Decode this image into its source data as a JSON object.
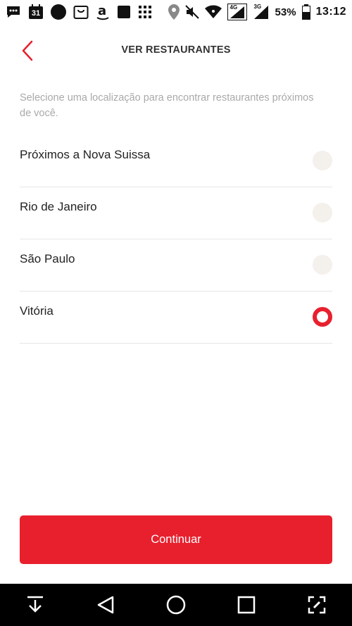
{
  "status_bar": {
    "calendar_day": "31",
    "network_4g": "4G",
    "network_3g": "3G",
    "battery": "53%",
    "time": "13:12",
    "icons": [
      "messages-icon",
      "calendar-icon",
      "record-icon",
      "shopping-icon",
      "amazon-icon",
      "square-icon",
      "grid-icon",
      "location-icon",
      "mute-icon",
      "wifi-icon",
      "signal-4g-icon",
      "signal-3g-icon",
      "battery-icon"
    ]
  },
  "header": {
    "title": "VER RESTAURANTES",
    "back_icon": "chevron-left-icon"
  },
  "intro": {
    "text": "Selecione uma localização para encontrar restaurantes próximos de você."
  },
  "locations": [
    {
      "label": "Próximos a Nova Suissa",
      "selected": false
    },
    {
      "label": "Rio de Janeiro",
      "selected": false
    },
    {
      "label": "São Paulo",
      "selected": false
    },
    {
      "label": "Vitória",
      "selected": true
    }
  ],
  "actions": {
    "continue_label": "Continuar"
  },
  "nav_bar": {
    "icons": [
      "download-icon",
      "back-triangle-icon",
      "home-circle-icon",
      "recents-square-icon",
      "edit-screen-icon"
    ]
  },
  "colors": {
    "accent": "#e8202e",
    "radio_unselected": "#f4f0ec",
    "text_primary": "#222222",
    "text_secondary": "#a9a9a9",
    "divider": "#e6e6e6"
  }
}
